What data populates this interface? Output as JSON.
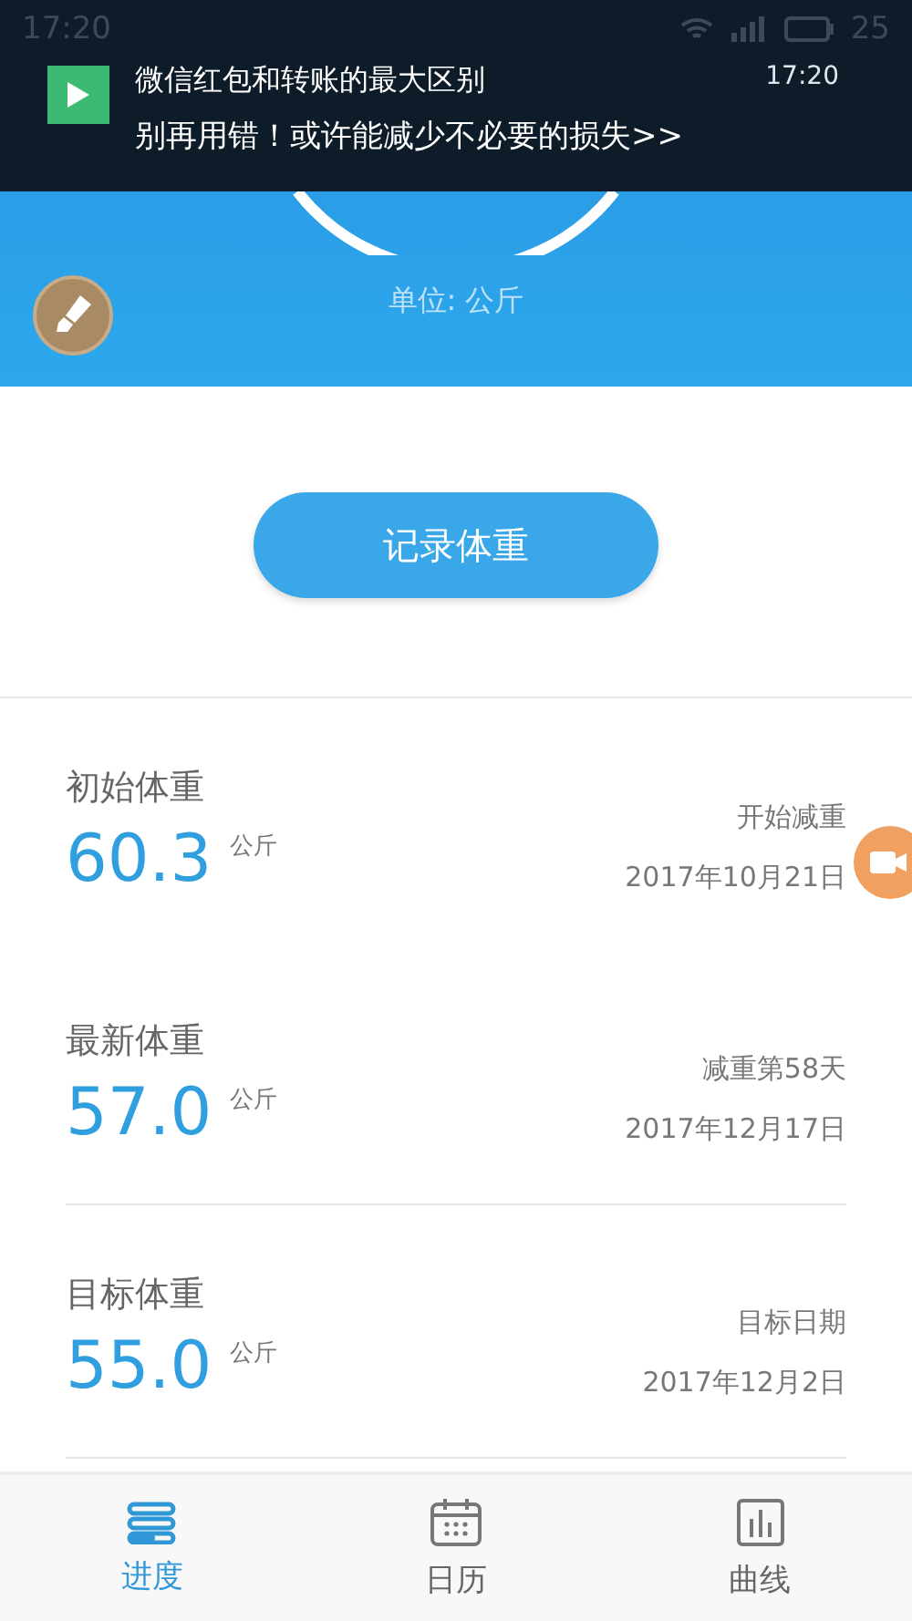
{
  "status_bar": {
    "time": "17:20",
    "battery": "25"
  },
  "notification": {
    "title": "微信红包和转账的最大区别",
    "message": "别再用错！或许能减少不必要的损失>>",
    "time": "17:20"
  },
  "header": {
    "unit_label": "单位: 公斤"
  },
  "record_button": "记录体重",
  "weights": [
    {
      "label": "初始体重",
      "value": "60.3",
      "unit": "公斤",
      "note": "开始减重",
      "date": "2017年10月21日"
    },
    {
      "label": "最新体重",
      "value": "57.0",
      "unit": "公斤",
      "note": "减重第58天",
      "date": "2017年12月17日"
    },
    {
      "label": "目标体重",
      "value": "55.0",
      "unit": "公斤",
      "note": "目标日期",
      "date": "2017年12月2日"
    }
  ],
  "tabs": [
    {
      "kind": "progress",
      "label": "进度",
      "selected": true
    },
    {
      "kind": "calendar",
      "label": "日历",
      "selected": false
    },
    {
      "kind": "chart",
      "label": "曲线",
      "selected": false
    }
  ]
}
